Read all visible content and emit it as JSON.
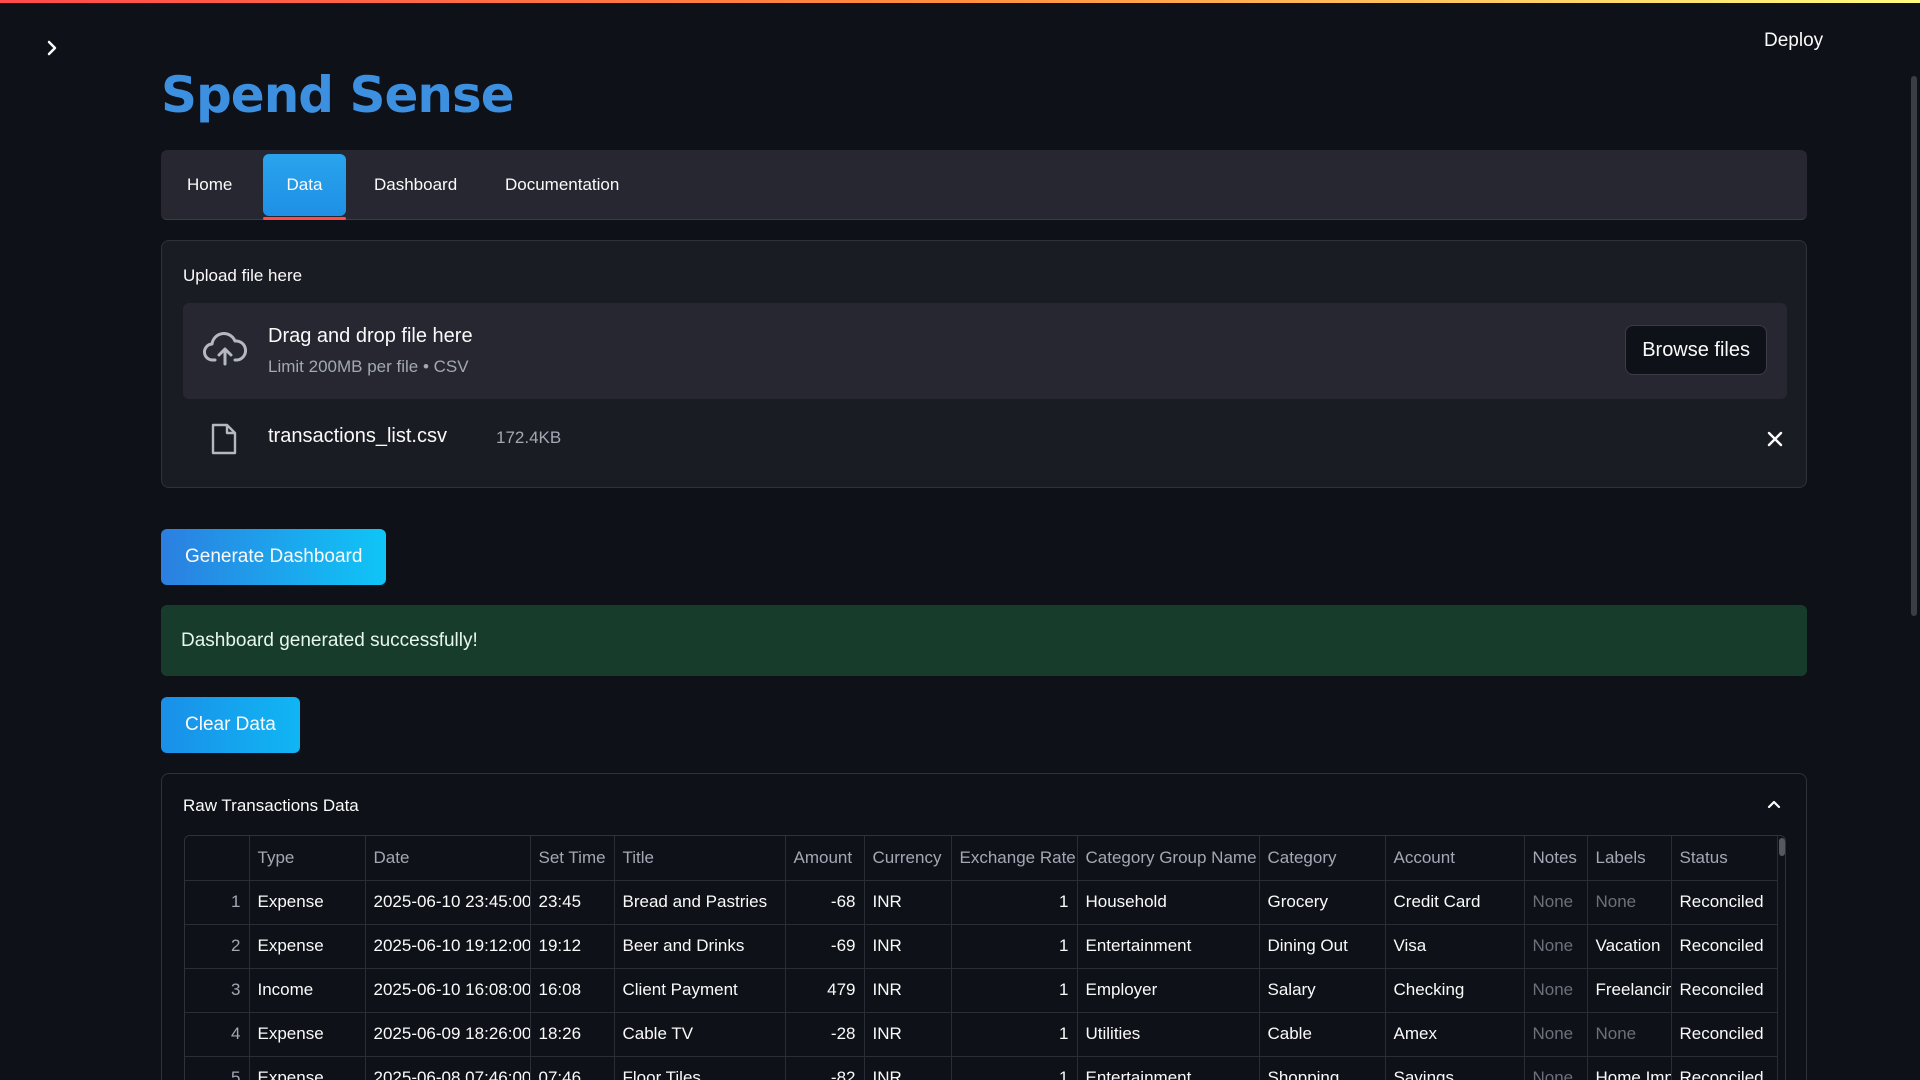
{
  "header": {
    "deploy_label": "Deploy"
  },
  "app": {
    "title": "Spend Sense"
  },
  "nav": {
    "tabs": [
      {
        "label": "Home",
        "active": false
      },
      {
        "label": "Data",
        "active": true
      },
      {
        "label": "Dashboard",
        "active": false
      },
      {
        "label": "Documentation",
        "active": false
      }
    ]
  },
  "uploader": {
    "label": "Upload file here",
    "drop_title": "Drag and drop file here",
    "drop_sub": "Limit 200MB per file • CSV",
    "browse_label": "Browse files",
    "file": {
      "name": "transactions_list.csv",
      "size": "172.4KB"
    }
  },
  "actions": {
    "generate_label": "Generate Dashboard",
    "success_message": "Dashboard generated successfully!",
    "clear_label": "Clear Data"
  },
  "expander": {
    "title": "Raw Transactions Data"
  },
  "table": {
    "columns": [
      "",
      "Type",
      "Date",
      "Set Time",
      "Title",
      "Amount",
      "Currency",
      "Exchange Rate",
      "Category Group Name",
      "Category",
      "Account",
      "Notes",
      "Labels",
      "Status"
    ],
    "rows": [
      [
        "1",
        "Expense",
        "2025-06-10 23:45:00",
        "23:45",
        "Bread and Pastries",
        "-68",
        "INR",
        "1",
        "Household",
        "Grocery",
        "Credit Card",
        "None",
        "None",
        "Reconciled"
      ],
      [
        "2",
        "Expense",
        "2025-06-10 19:12:00",
        "19:12",
        "Beer and Drinks",
        "-69",
        "INR",
        "1",
        "Entertainment",
        "Dining Out",
        "Visa",
        "None",
        "Vacation",
        "Reconciled"
      ],
      [
        "3",
        "Income",
        "2025-06-10 16:08:00",
        "16:08",
        "Client Payment",
        "479",
        "INR",
        "1",
        "Employer",
        "Salary",
        "Checking",
        "None",
        "Freelancing",
        "Reconciled"
      ],
      [
        "4",
        "Expense",
        "2025-06-09 18:26:00",
        "18:26",
        "Cable TV",
        "-28",
        "INR",
        "1",
        "Utilities",
        "Cable",
        "Amex",
        "None",
        "None",
        "Reconciled"
      ],
      [
        "5",
        "Expense",
        "2025-06-08 07:46:00",
        "07:46",
        "Floor Tiles",
        "-82",
        "INR",
        "1",
        "Entertainment",
        "Shopping",
        "Savings",
        "None",
        "Home Improvement",
        "Reconciled"
      ]
    ]
  }
}
